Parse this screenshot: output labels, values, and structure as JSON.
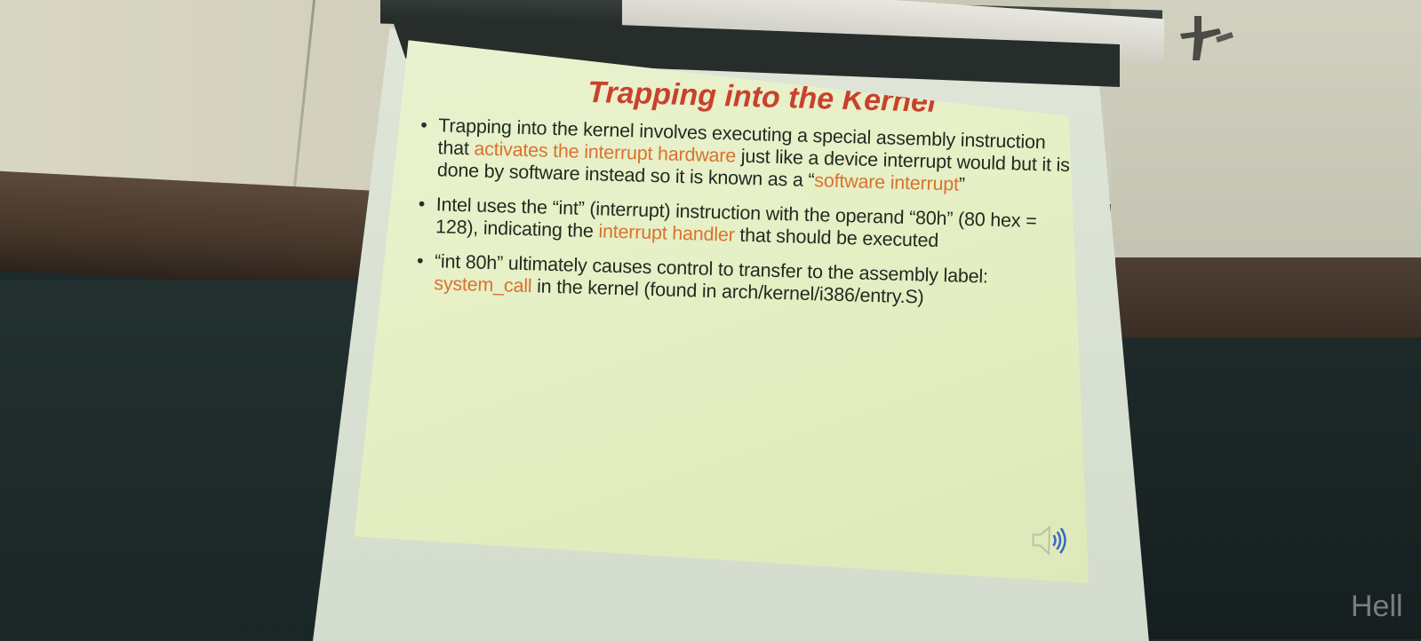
{
  "slide": {
    "title": "Trapping into the Kernel",
    "bullets": [
      {
        "parts": [
          {
            "text": "Trapping into the kernel involves executing a special assembly instruction that ",
            "hl": false
          },
          {
            "text": "activates the interrupt hardware",
            "hl": true
          },
          {
            "text": " just like a device interrupt would but it is done by software instead so it is known as a “",
            "hl": false
          },
          {
            "text": "software interrupt",
            "hl": true
          },
          {
            "text": "”",
            "hl": false
          }
        ]
      },
      {
        "parts": [
          {
            "text": "Intel uses the “int” (interrupt) instruction with the operand “80h” (80 hex = 128), indicating the ",
            "hl": false
          },
          {
            "text": "interrupt handler",
            "hl": true
          },
          {
            "text": " that should be executed",
            "hl": false
          }
        ]
      },
      {
        "parts": [
          {
            "text": "“int 80h” ultimately causes control to transfer to the assembly label: ",
            "hl": false
          },
          {
            "text": "system_call",
            "hl": true
          },
          {
            "text": " in the kernel (found in arch/kernel/i386/entry.S)",
            "hl": false
          }
        ]
      }
    ],
    "icons": {
      "speaker": "speaker-icon"
    }
  },
  "chalkboard": {
    "text": "Hell"
  },
  "colors": {
    "title": "#c9412c",
    "highlight": "#d9722e",
    "body_text": "#1f2a20",
    "slide_bg": "#e7f0c7"
  }
}
